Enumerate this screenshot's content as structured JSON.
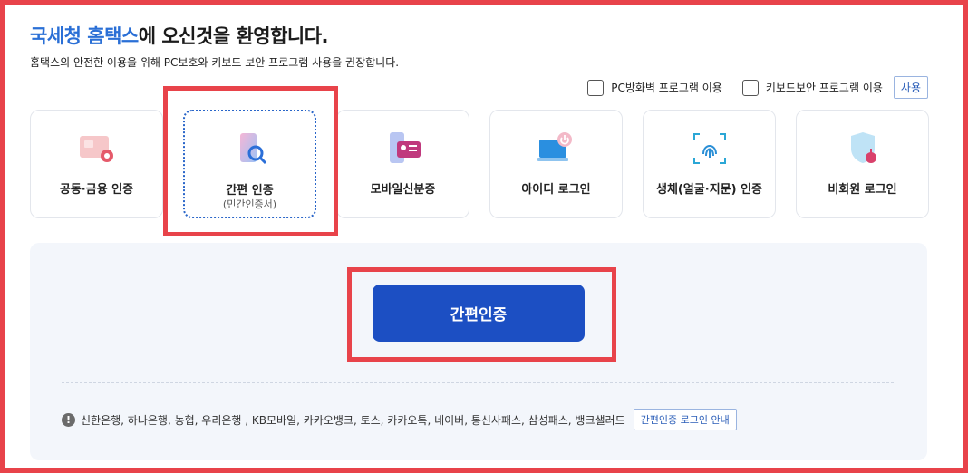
{
  "header": {
    "title_brand": "국세청 홈택스",
    "title_rest": "에 오신것을 환영합니다.",
    "subtitle": "홈택스의 안전한 이용을 위해 PC보호와 키보드 보안 프로그램 사용을 권장합니다."
  },
  "options": {
    "firewall_label": "PC방화벽 프로그램 이용",
    "keyboard_label": "키보드보안 프로그램 이용",
    "use_button": "사용"
  },
  "methods": [
    {
      "label": "공동·금융 인증",
      "icon": "certificate-icon"
    },
    {
      "label": "간편 인증",
      "sub": "(민간인증서)",
      "icon": "phone-search-icon",
      "active": true
    },
    {
      "label": "모바일신분증",
      "icon": "mobile-id-icon"
    },
    {
      "label": "아이디 로그인",
      "icon": "laptop-power-icon"
    },
    {
      "label": "생체(얼굴·지문) 인증",
      "icon": "fingerprint-icon"
    },
    {
      "label": "비회원 로그인",
      "icon": "shield-thermometer-icon"
    }
  ],
  "panel": {
    "main_button": "간편인증",
    "providers": "신한은행, 하나은행, 농협, 우리은행 , KB모바일, 카카오뱅크, 토스, 카카오톡, 네이버, 통신사패스, 삼성패스, 뱅크샐러드",
    "guide_button": "간편인증 로그인 안내"
  },
  "colors": {
    "brand": "#2a6fd6",
    "primary_button": "#1c4fc3",
    "highlight": "#e8434a"
  }
}
